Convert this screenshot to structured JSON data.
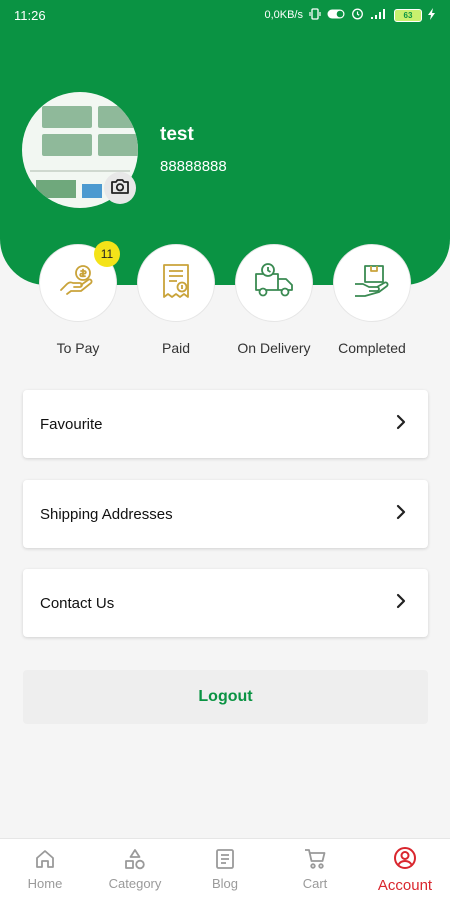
{
  "status_bar": {
    "time": "11:26",
    "network_speed": "0,0KB/s",
    "battery": "63"
  },
  "profile": {
    "name": "test",
    "phone": "88888888"
  },
  "orders": [
    {
      "label": "To Pay",
      "badge": "11",
      "icon": "hand-coin-icon"
    },
    {
      "label": "Paid",
      "icon": "receipt-icon"
    },
    {
      "label": "On Delivery",
      "icon": "truck-icon"
    },
    {
      "label": "Completed",
      "icon": "box-hand-icon"
    }
  ],
  "menu": [
    {
      "label": "Favourite"
    },
    {
      "label": "Shipping Addresses"
    },
    {
      "label": "Contact Us"
    }
  ],
  "logout_label": "Logout",
  "bottom_nav": [
    {
      "label": "Home",
      "icon": "home-icon"
    },
    {
      "label": "Category",
      "icon": "category-icon"
    },
    {
      "label": "Blog",
      "icon": "blog-icon"
    },
    {
      "label": "Cart",
      "icon": "cart-icon"
    },
    {
      "label": "Account",
      "icon": "account-icon",
      "active": true
    }
  ],
  "colors": {
    "primary_green": "#0a9343",
    "active_red": "#d9262e",
    "badge_yellow": "#f4e319",
    "order_icon_gold": "#c9a33a",
    "order_icon_green": "#3a8a52"
  }
}
